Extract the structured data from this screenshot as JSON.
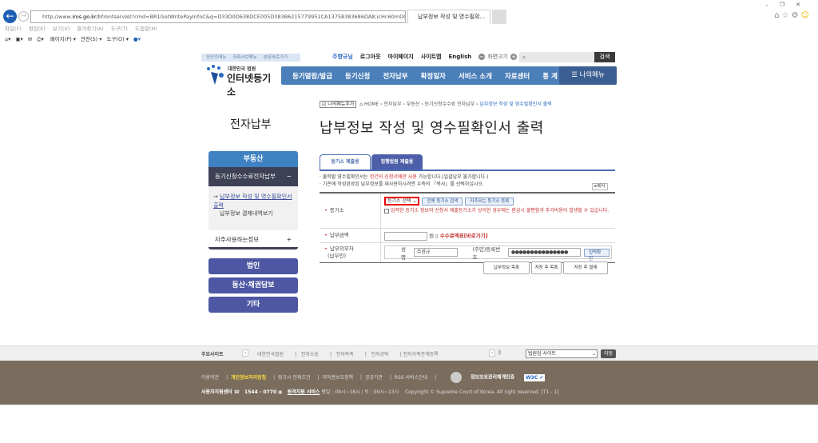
{
  "browser": {
    "url_prefix": "http://www.",
    "url_domain": "iros.go.kr",
    "url_rest": "/bfrontservlet?cmd=BR1GetWritePayInfoC&q=D33D0D638DCE005D383B6215779951CA13758383686DA8;icHc60mDQkkdA",
    "tab_title": "납부정보 작성 및 영수필확...",
    "menu": [
      "파일(F)",
      "편집(E)",
      "보기(V)",
      "즐겨찾기(A)",
      "도구(T)",
      "도움말(H)"
    ],
    "toolbar": [
      "페이지(P) ▾",
      "안전(S) ▾",
      "도구(O) ▾"
    ]
  },
  "header": {
    "util_links": [
      "상단주메뉴",
      "좌측서브메뉴",
      "본문바로가기"
    ],
    "top_links": [
      "주향규님",
      "로그아웃",
      "마이페이지",
      "사이트맵",
      "English"
    ],
    "font_size_label": "화면크기",
    "search_button": "검색",
    "logo_small": "대한민국 법원",
    "logo_big": "인터넷등기소",
    "nav": [
      "등기열람/발급",
      "등기신청",
      "전자납부",
      "확정일자",
      "서비스 소개",
      "자료센터",
      "통 계"
    ],
    "my_menu": "나의메뉴"
  },
  "sidebar": {
    "title": "전자납부",
    "real_estate": "부동산",
    "fee_payment": "등기신청수수료전자납부",
    "fee_toggle": "−",
    "sub_active": "납부정보 작성 및 영수필확인서 출력",
    "sub_other": "납부정보 결제내역보기",
    "frequent": "자주사용하는정보",
    "frequent_toggle": "+",
    "corp": "법인",
    "movable": "동산·채권담보",
    "etc": "기타"
  },
  "content": {
    "my_menu_add": "나의메뉴추가",
    "breadcrumb": [
      "HOME",
      "전자납부",
      "부동산",
      "등기신청수수료 전자납부",
      "납부정보 작성 및 영수필확인서 출력"
    ],
    "title": "납부정보 작성 및 영수필확인서 출력",
    "tabs": [
      "등기소 제출용",
      "집행법원 제출용"
    ],
    "note1_a": "· 출력할 영수필확인서는 ",
    "note1_red": "한건의 신청서에만 사용",
    "note1_b": " 가능합니다.(일괄납부 불가합니다.)",
    "note2": "· 기존에 작성완료된 납부정보를 재사용하시려면 우측의 『복사』를 선택하십시오.",
    "copy_button": "▸복사",
    "registry_label": "등기소",
    "registry_select": "등기소 선택",
    "all_registry_search": "전체 등기소 검색",
    "frequent_registry": "자주쓰는 등기소 등록",
    "warning": "입력한 등기소 정보와 신청서 제출등기소가 상이한 경우에는 환급시 불편함과 추가비용이 발생할 수 있습니다.",
    "amount_label": "납부금액",
    "amount_value": "",
    "won": "원",
    "fee_table_link": "수수료액표[바로가기]",
    "payer_label": "납부의무자",
    "payer_sub": "(납부인)",
    "name_label": "성명",
    "name_value": "주향규",
    "id_label": "(주민)등록번호",
    "id_value": "●●●●●●●●●●●●●●●",
    "confirm_button": "입력확인",
    "buttons": [
      "납부정보 목록",
      "저장 후 목록",
      "저장 후 결제"
    ]
  },
  "footer": {
    "sites_label": "주요사이트",
    "sites": [
      "대한민국법원",
      "전자소송",
      "전자독촉",
      "전자공탁",
      "전자가족관계등록"
    ],
    "site_select": "법원업 사이트",
    "go_button": "이동",
    "links": [
      "이용약관",
      "개인정보처리방침",
      "링크시 전제조건",
      "저작권보호정책",
      "공공기관",
      "RSS 서비스안내"
    ],
    "isms": "정보보호관리체계인증",
    "support_center": "사용자지원센터",
    "phone": "1544 - 0770",
    "remote": "원격지원 서비스",
    "hours": "평일 : 09시~18시 / 토 : 09시~13시",
    "copyright": "Copyright © Supreme Court of Korea. All right reserved.  [T1 - 1]"
  }
}
